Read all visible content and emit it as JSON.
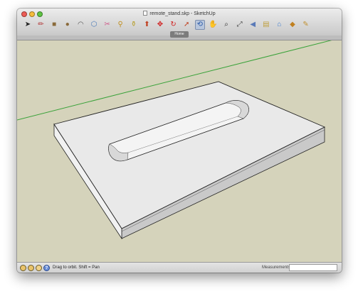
{
  "window": {
    "title": "remote_stand.skp - SketchUp"
  },
  "toolbar": {
    "tools": [
      {
        "name": "select-arrow-icon",
        "glyph": "➤",
        "color": "#222222"
      },
      {
        "name": "pencil-icon",
        "glyph": "✏",
        "color": "#b03030"
      },
      {
        "name": "rectangle-icon",
        "glyph": "■",
        "color": "#8a6a3a"
      },
      {
        "name": "circle-icon",
        "glyph": "●",
        "color": "#8a6a3a"
      },
      {
        "name": "arc-icon",
        "glyph": "◠",
        "color": "#555555"
      },
      {
        "name": "make-component-icon",
        "glyph": "⬡",
        "color": "#4a7ab8"
      },
      {
        "name": "eraser-icon",
        "glyph": "✂",
        "color": "#d05a8a"
      },
      {
        "name": "tape-measure-icon",
        "glyph": "⚲",
        "color": "#c09020"
      },
      {
        "name": "paint-bucket-icon",
        "glyph": "⚱",
        "color": "#b8a030"
      },
      {
        "name": "push-pull-icon",
        "glyph": "⬆",
        "color": "#c04020"
      },
      {
        "name": "move-icon",
        "glyph": "✥",
        "color": "#d02020"
      },
      {
        "name": "rotate-icon",
        "glyph": "↻",
        "color": "#d02020"
      },
      {
        "name": "follow-me-icon",
        "glyph": "➚",
        "color": "#c04020"
      },
      {
        "name": "orbit-icon",
        "glyph": "⟲",
        "color": "#2a5aa8"
      },
      {
        "name": "pan-hand-icon",
        "glyph": "✋",
        "color": "#777777"
      },
      {
        "name": "zoom-icon",
        "glyph": "⌕",
        "color": "#333333"
      },
      {
        "name": "zoom-extents-icon",
        "glyph": "⤢",
        "color": "#444444"
      },
      {
        "name": "previous-view-icon",
        "glyph": "◀",
        "color": "#5a7ab8"
      },
      {
        "name": "shadows-icon",
        "glyph": "▤",
        "color": "#c0a040"
      },
      {
        "name": "warehouse-icon",
        "glyph": "⌂",
        "color": "#3a7ad0"
      },
      {
        "name": "components-icon",
        "glyph": "◆",
        "color": "#c08020"
      },
      {
        "name": "styles-icon",
        "glyph": "✎",
        "color": "#c09030"
      }
    ],
    "active_tool": "orbit-icon"
  },
  "scenes": {
    "tab_label": "Home"
  },
  "status": {
    "message": "Drag to orbit.  Shift = Pan",
    "measurements_label": "Measurements",
    "measurements_value": ""
  },
  "colors": {
    "viewport_background": "#d5d3bb",
    "model_top": "#e9e9e9",
    "model_front": "#f1f1f1",
    "model_side": "#c9c9c9",
    "slot_wall": "#d8d8d8",
    "axis_green": "#3aa23a"
  }
}
